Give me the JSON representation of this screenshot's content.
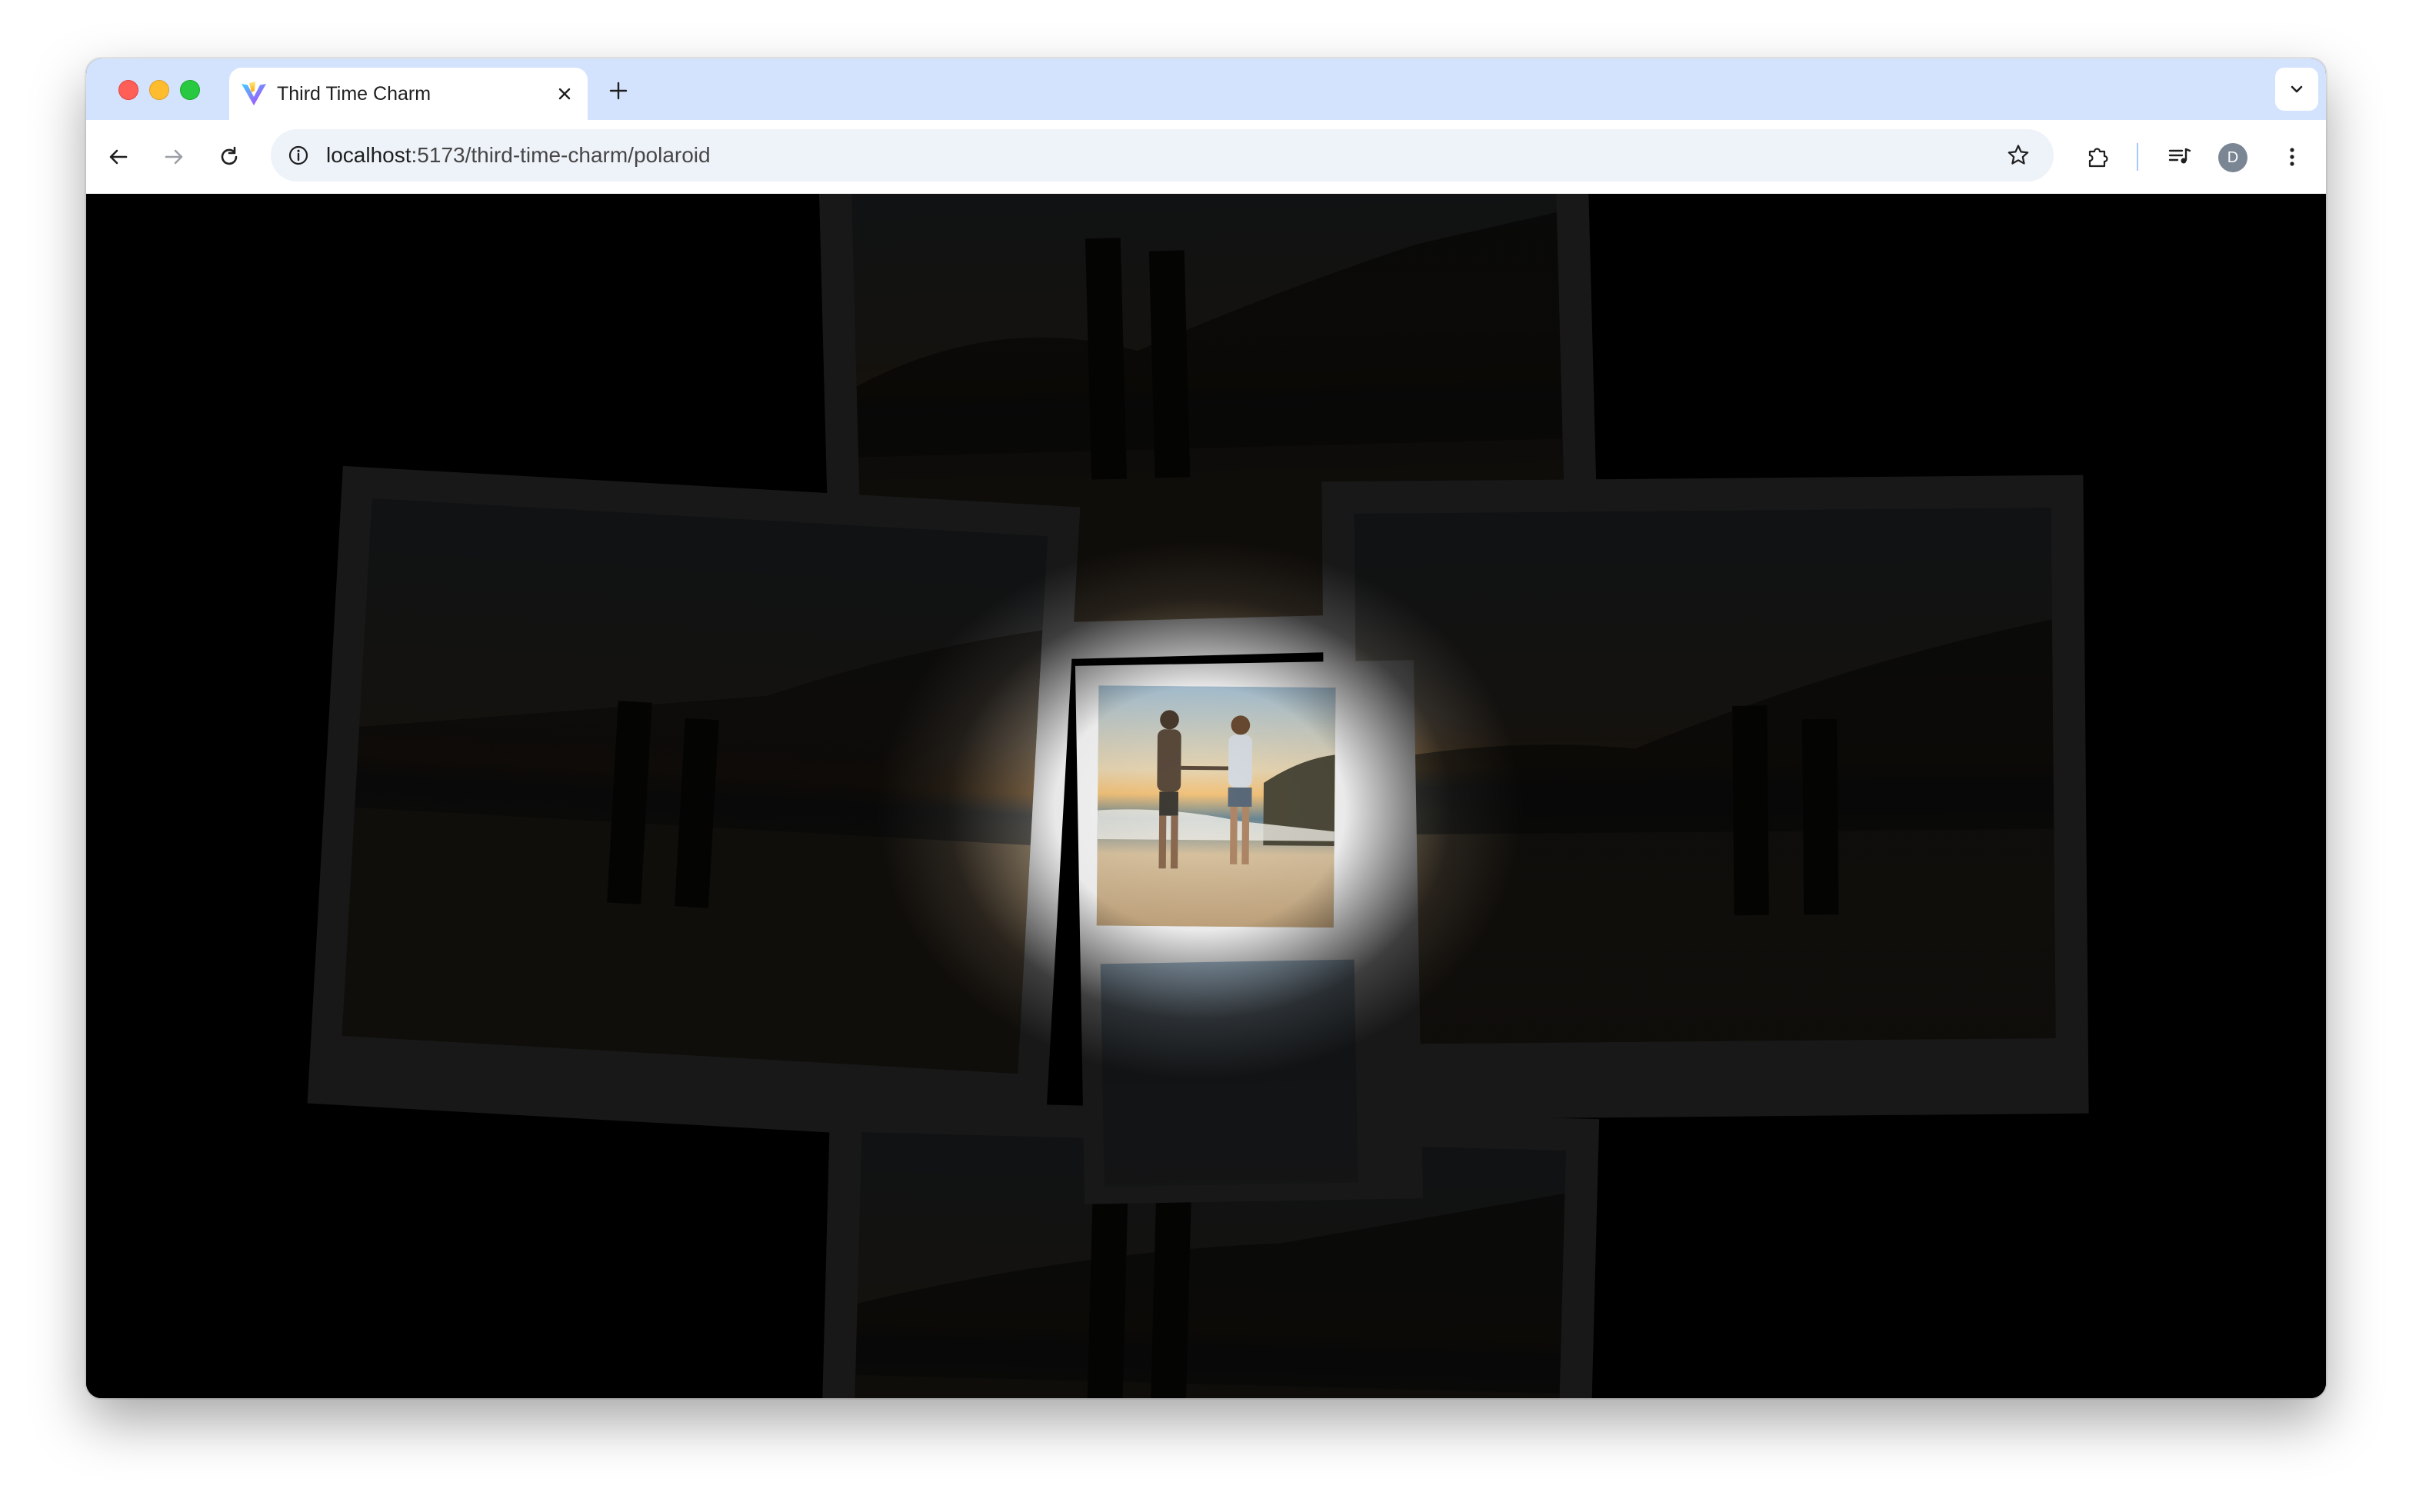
{
  "browser": {
    "tab": {
      "title": "Third Time Charm",
      "favicon": "vite-logo-icon"
    },
    "address_bar": {
      "host": "localhost",
      "path": ":5173/third-time-charm/polaroid"
    },
    "profile_initial": "D",
    "icons": {
      "back": "arrow-left-icon",
      "forward": "arrow-right-icon",
      "reload": "reload-icon",
      "site_info": "info-icon",
      "bookmark": "star-icon",
      "extensions": "puzzle-icon",
      "media": "media-queue-icon",
      "menu": "kebab-menu-icon",
      "tab_search": "chevron-down-icon",
      "new_tab": "plus-icon",
      "close_tab": "close-icon"
    }
  },
  "page": {
    "background_color": "#000000",
    "frame_color": "#f4f4f4",
    "photo_subject": "couple walking hand in hand on beach at sunset"
  }
}
